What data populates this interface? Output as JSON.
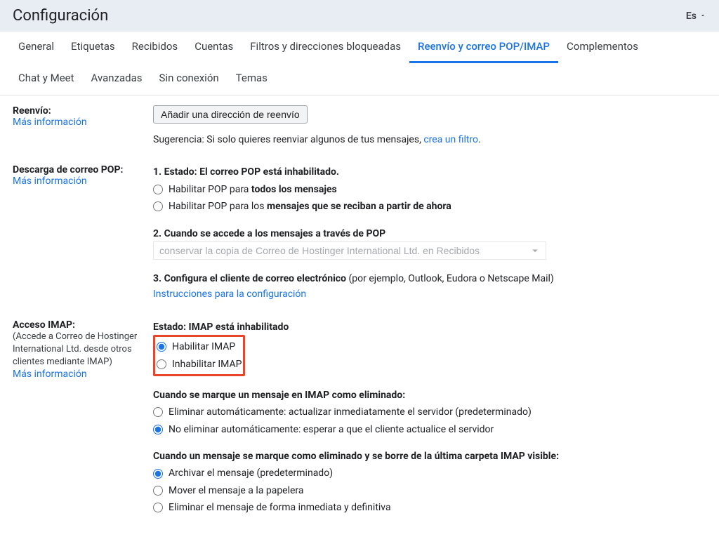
{
  "header": {
    "title": "Configuración",
    "language": "Es"
  },
  "tabs": [
    "General",
    "Etiquetas",
    "Recibidos",
    "Cuentas",
    "Filtros y direcciones bloqueadas",
    "Reenvío y correo POP/IMAP",
    "Complementos",
    "Chat y Meet",
    "Avanzadas",
    "Sin conexión",
    "Temas"
  ],
  "forwarding": {
    "title": "Reenvío:",
    "more_info": "Más información",
    "add_button": "Añadir una dirección de reenvío",
    "suggestion_prefix": "Sugerencia: Si solo quieres reenviar algunos de tus mensajes, ",
    "suggestion_link": "crea un filtro",
    "suggestion_suffix": "."
  },
  "pop": {
    "title": "Descarga de correo POP:",
    "more_info": "Más información",
    "status_prefix": "1. Estado: ",
    "status_bold": "El correo POP está inhabilitado.",
    "opt1_prefix": "Habilitar POP para ",
    "opt1_bold": "todos los mensajes",
    "opt2_prefix": "Habilitar POP para los ",
    "opt2_bold": "mensajes que se reciban a partir de ahora",
    "step2_title": "2. Cuando se accede a los mensajes a través de POP",
    "select_value": "conservar la copia de Correo de Hostinger International Ltd. en Recibidos",
    "step3_prefix": "3. Configura el cliente de correo electrónico ",
    "step3_paren": "(por ejemplo, Outlook, Eudora o Netscape Mail)",
    "step3_link": "Instrucciones para la configuración"
  },
  "imap": {
    "title": "Acceso IMAP:",
    "sub": "(Accede a Correo de Hostinger International Ltd. desde otros clientes mediante IMAP)",
    "more_info": "Más información",
    "status_prefix": "Estado: ",
    "status_bold": "IMAP está inhabilitado",
    "enable": "Habilitar IMAP",
    "disable": "Inhabilitar IMAP",
    "deleted_title": "Cuando se marque un mensaje en IMAP como eliminado:",
    "deleted_opt1": "Eliminar automáticamente: actualizar inmediatamente el servidor (predeterminado)",
    "deleted_opt2": "No eliminar automáticamente: esperar a que el cliente actualice el servidor",
    "last_folder_title": "Cuando un mensaje se marque como eliminado y se borre de la última carpeta IMAP visible:",
    "last_opt1": "Archivar el mensaje (predeterminado)",
    "last_opt2": "Mover el mensaje a la papelera",
    "last_opt3": "Eliminar el mensaje de forma inmediata y definitiva"
  }
}
